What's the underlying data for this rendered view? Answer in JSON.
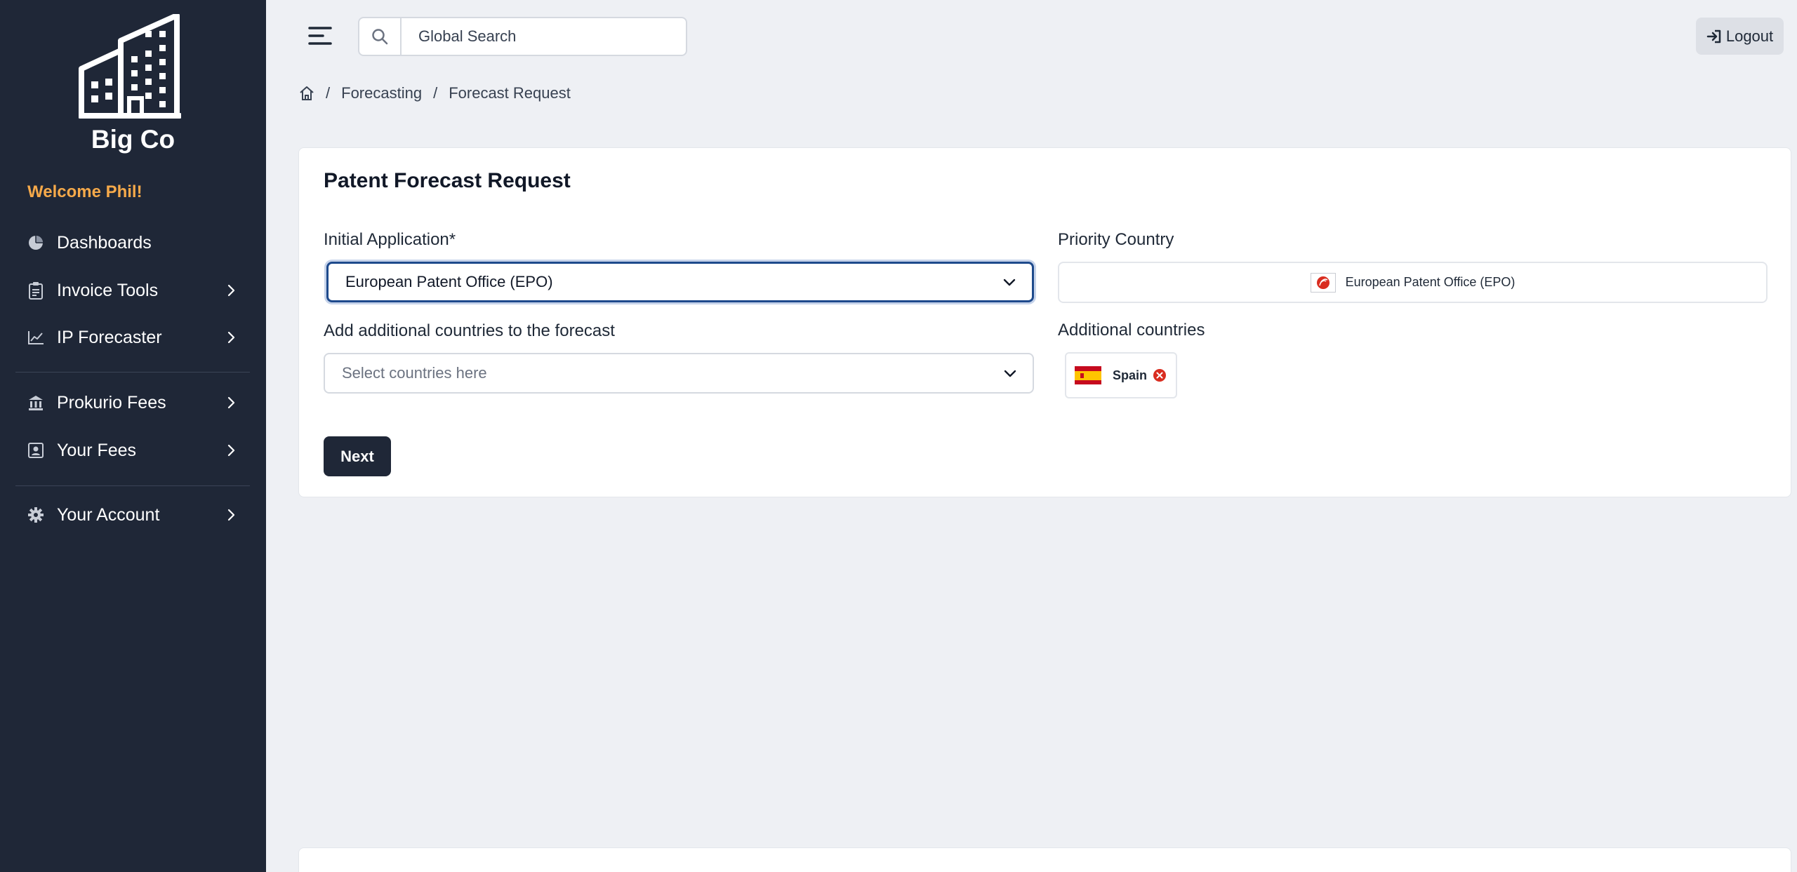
{
  "sidebar": {
    "brand": "Big Co",
    "welcome": "Welcome Phil!",
    "items": [
      {
        "label": "Dashboards",
        "icon": "pie-chart-icon",
        "has_children": false
      },
      {
        "label": "Invoice Tools",
        "icon": "clipboard-icon",
        "has_children": true
      },
      {
        "label": "IP Forecaster",
        "icon": "line-chart-icon",
        "has_children": true
      },
      {
        "label": "Prokurio Fees",
        "icon": "bank-icon",
        "has_children": true
      },
      {
        "label": "Your Fees",
        "icon": "user-card-icon",
        "has_children": true
      },
      {
        "label": "Your Account",
        "icon": "gear-icon",
        "has_children": true
      }
    ]
  },
  "topbar": {
    "search_placeholder": "Global Search",
    "logout_label": "Logout"
  },
  "breadcrumb": [
    "Forecasting",
    "Forecast Request"
  ],
  "form": {
    "title": "Patent Forecast Request",
    "initial_application_label": "Initial Application*",
    "initial_application_value": "European Patent Office (EPO)",
    "additional_countries_label": "Add additional countries to the forecast",
    "additional_countries_placeholder": "Select countries here",
    "priority_country_label": "Priority Country",
    "priority_country_value": "European Patent Office (EPO)",
    "selected_countries_label": "Additional countries",
    "selected_countries": [
      "Spain"
    ],
    "next_label": "Next"
  },
  "colors": {
    "sidebar_bg": "#1f2737",
    "welcome": "#f5a94a",
    "focus_border": "#1e4a8c",
    "remove_icon": "#d92d20"
  }
}
